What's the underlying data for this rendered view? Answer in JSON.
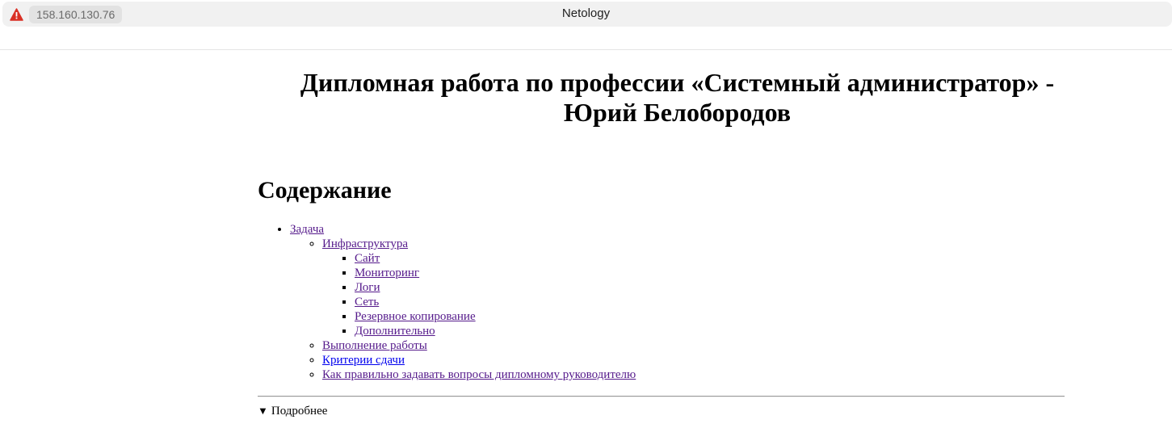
{
  "browser": {
    "url": "158.160.130.76",
    "tab_title": "Netology",
    "warning_icon": "not-secure-warning-icon",
    "warning_color": "#d93025"
  },
  "page": {
    "title": "Дипломная работа по профессии «Системный администратор» - Юрий Белобородов",
    "toc_heading": "Содержание",
    "toc": {
      "task": "Задача",
      "infrastructure": "Инфраструктура",
      "site": "Сайт",
      "monitoring": "Мониторинг",
      "logs": "Логи",
      "network": "Сеть",
      "backup": "Резервное копирование",
      "additional": "Дополнительно",
      "execution": "Выполнение работы",
      "criteria": "Критерии сдачи",
      "questions": "Как правильно задавать вопросы дипломному руководителю"
    },
    "details_label": "Подробнее",
    "colors": {
      "visited_link": "#551a8b",
      "unvisited_link": "#0000ee"
    }
  }
}
